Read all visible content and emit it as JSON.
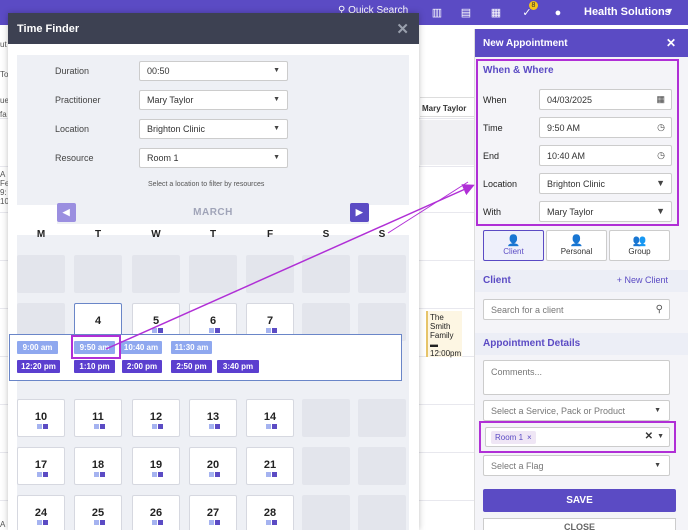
{
  "topbar": {
    "search_label": "Quick Search",
    "brand": "Health Solutions",
    "task_badge": "8",
    "icons": [
      "chart-icon",
      "clipboard-icon",
      "calendar-icon",
      "tasks-icon",
      "chat-icon"
    ]
  },
  "background": {
    "column_header": "Mary Taylor",
    "event": {
      "line1": "The",
      "line2": "Smith",
      "line3": "Family",
      "time": "12:00pm"
    },
    "left_fragments": [
      "ut",
      "To",
      "ue",
      "fa",
      "A",
      "Fe",
      "9:",
      "10",
      "A",
      "R"
    ]
  },
  "time_finder": {
    "title": "Time Finder",
    "close_glyph": "✕",
    "fields": {
      "duration_label": "Duration",
      "duration_value": "00:50",
      "practitioner_label": "Practitioner",
      "practitioner_value": "Mary Taylor",
      "location_label": "Location",
      "location_value": "Brighton Clinic",
      "resource_label": "Resource",
      "resource_value": "Room 1",
      "resource_hint": "Select a location to filter by resources"
    },
    "month": "MARCH",
    "weekdays": [
      "M",
      "T",
      "W",
      "T",
      "F",
      "S",
      "S"
    ],
    "week1": [
      "4",
      "5",
      "6",
      "7"
    ],
    "week2": [
      "10",
      "11",
      "12",
      "13",
      "14"
    ],
    "week3": [
      "17",
      "18",
      "19",
      "20",
      "21"
    ],
    "week4": [
      "24",
      "25",
      "26",
      "27",
      "28"
    ],
    "slots_row1": [
      "9:00 am",
      "9:50 am",
      "10:40 am",
      "11:30 am"
    ],
    "slots_row2": [
      "12:20 pm",
      "1:10 pm",
      "2:00 pm",
      "2:50 pm",
      "3:40 pm"
    ]
  },
  "new_appointment": {
    "title": "New Appointment",
    "close_glyph": "✕",
    "when_where_title": "When & Where",
    "when_label": "When",
    "when_value": "04/03/2025",
    "time_label": "Time",
    "time_value": "9:50 AM",
    "end_label": "End",
    "end_value": "10:40 AM",
    "location_label": "Location",
    "location_value": "Brighton Clinic",
    "with_label": "With",
    "with_value": "Mary Taylor",
    "types": [
      "Client",
      "Personal",
      "Group"
    ],
    "client_title": "Client",
    "new_client": "+ New Client",
    "client_search_placeholder": "Search for a client",
    "details_title": "Appointment Details",
    "comments_placeholder": "Comments...",
    "service_placeholder": "Select a Service, Pack or Product",
    "resource_chip": "Room 1",
    "flag_placeholder": "Select a Flag",
    "save_label": "SAVE",
    "close_label": "CLOSE"
  },
  "colors": {
    "brand": "#5b4bc4",
    "highlight": "#b02fd6",
    "header_dark": "#3d4152"
  }
}
